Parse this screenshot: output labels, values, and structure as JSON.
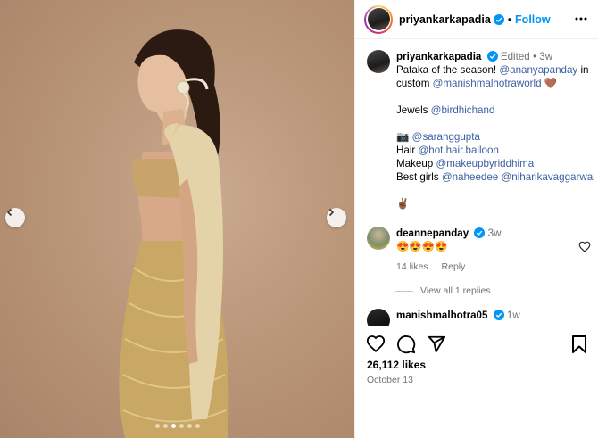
{
  "photo": {
    "alt_icon_prev": "chevron-left-icon",
    "alt_icon_next": "chevron-right-icon",
    "slide_count": 6,
    "active_slide": 2
  },
  "header": {
    "username": "priyankarkapadia",
    "separator": "•",
    "follow_label": "Follow",
    "more_icon": "more-horizontal-icon"
  },
  "caption": {
    "username": "priyankarkapadia",
    "edited": "Edited",
    "dot": "•",
    "age": "3w",
    "line1_text": "Pataka of the season! ",
    "line1_mention": "@ananyapanday",
    "line1_after": " in",
    "line2_text": "custom ",
    "line2_mention": "@manishmalhotraworld",
    "line2_emoji": "🤎",
    "jewels_label": "Jewels ",
    "jewels_mention": "@birdhichand",
    "camera_emoji": "📷",
    "photo_mention": "@saranggupta",
    "hair_label": "Hair ",
    "hair_mention": "@hot.hair.balloon",
    "makeup_label": "Makeup ",
    "makeup_mention": "@makeupbyriddhima",
    "bestgirls_label": "Best girls ",
    "bestgirls_mention1": "@naheedee",
    "bestgirls_mention2": "@niharikavaggarwal",
    "peace_emoji": "✌🏾"
  },
  "comments": [
    {
      "username": "deannepanday",
      "age": "3w",
      "text": "😍😍😍😍",
      "likes": "14 likes",
      "reply": "Reply"
    },
    {
      "username": "manishmalhotra05",
      "age": "1w"
    }
  ],
  "view_replies": "View all 1 replies",
  "footer": {
    "likes": "26,112 likes",
    "date": "October 13"
  },
  "colors": {
    "link_blue": "#0095f6",
    "mention": "#00376b",
    "secondary": "#737373",
    "photo_bg": "#bb977a"
  }
}
